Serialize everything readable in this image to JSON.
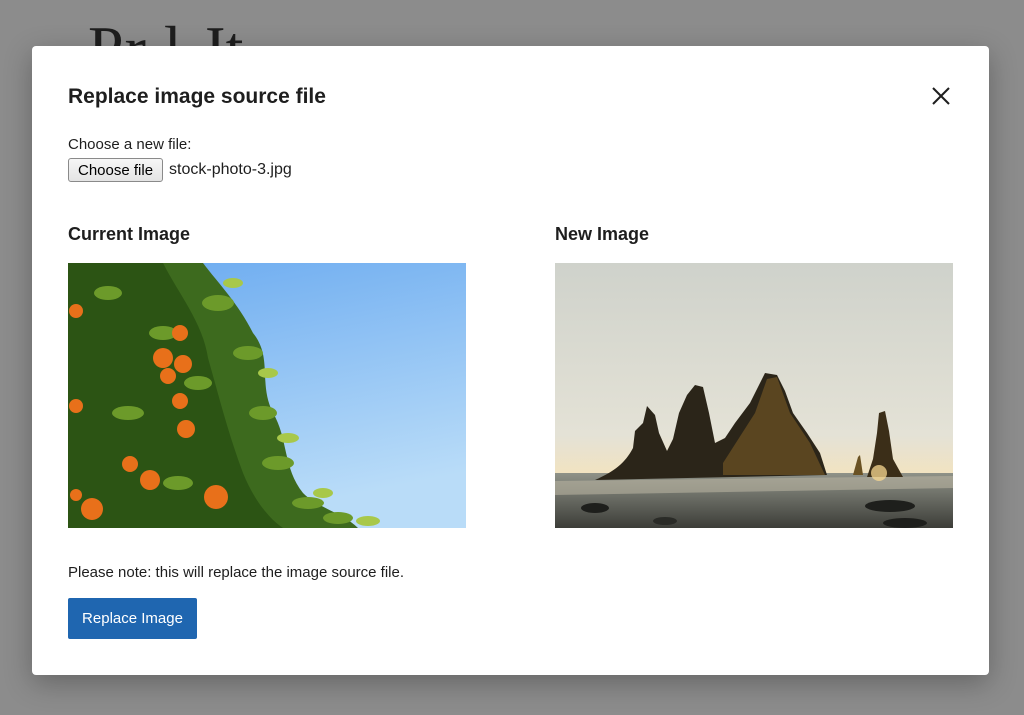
{
  "background": {
    "title_fragment": "Pr l Jt"
  },
  "modal": {
    "title": "Replace image source file",
    "file_label": "Choose a new file:",
    "choose_file_label": "Choose file",
    "file_name": "stock-photo-3.jpg",
    "current_heading": "Current Image",
    "new_heading": "New Image",
    "note": "Please note: this will replace the image source file.",
    "replace_button_label": "Replace Image",
    "close_icon": "close-icon"
  },
  "images": {
    "current": {
      "subject": "orange-tree-against-blue-sky"
    },
    "new": {
      "subject": "sea-stacks-at-sunset"
    }
  },
  "colors": {
    "primary": "#1f66b0",
    "overlay": "#8c8c8c",
    "text": "#1e1e1e"
  }
}
